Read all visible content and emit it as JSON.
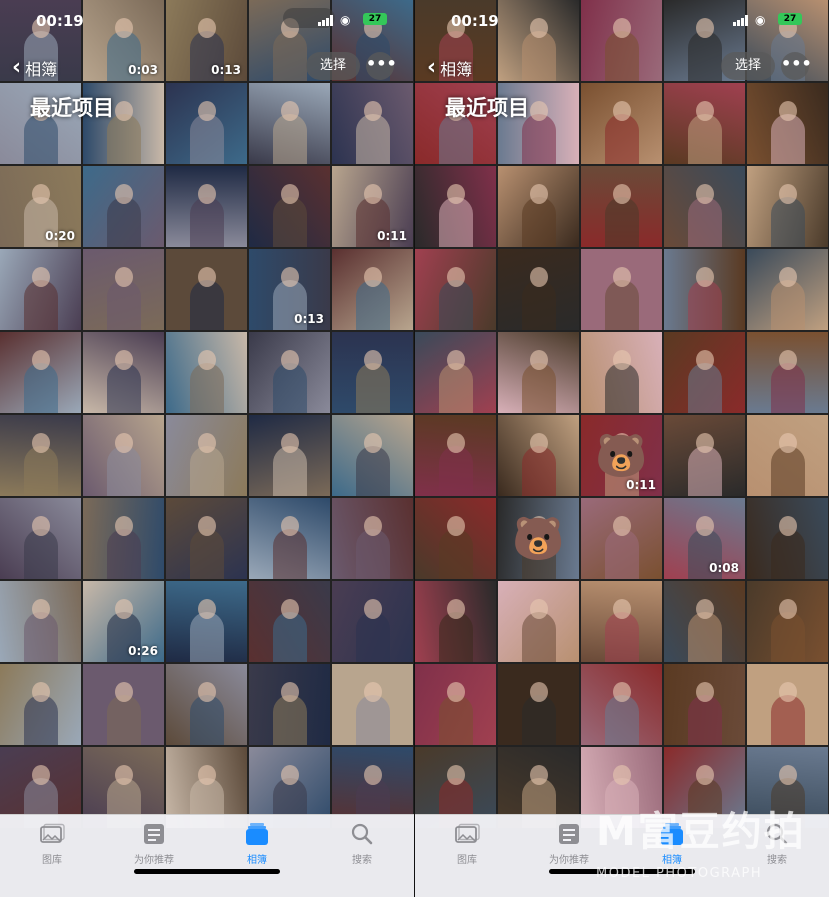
{
  "screens": [
    {
      "time": "00:19",
      "battery": "27",
      "back_label": "相簿",
      "title": "最近项目",
      "select_label": "选择",
      "more_label": "•••",
      "tabs": [
        {
          "label": "图库",
          "icon": "photos-icon",
          "active": false
        },
        {
          "label": "为你推荐",
          "icon": "for-you-icon",
          "active": false
        },
        {
          "label": "相簿",
          "icon": "albums-icon",
          "active": true
        },
        {
          "label": "搜索",
          "icon": "search-icon",
          "active": false
        }
      ],
      "durations": [
        {
          "row": 0,
          "col": 1,
          "text": "0:03"
        },
        {
          "row": 0,
          "col": 2,
          "text": "0:13"
        },
        {
          "row": 2,
          "col": 0,
          "text": "0:20"
        },
        {
          "row": 2,
          "col": 4,
          "text": "0:11"
        },
        {
          "row": 3,
          "col": 3,
          "text": "0:13"
        },
        {
          "row": 7,
          "col": 1,
          "text": "0:26"
        }
      ],
      "bears": []
    },
    {
      "time": "00:19",
      "battery": "27",
      "back_label": "相簿",
      "title": "最近项目",
      "select_label": "选择",
      "more_label": "•••",
      "tabs": [
        {
          "label": "图库",
          "icon": "photos-icon",
          "active": false
        },
        {
          "label": "为你推荐",
          "icon": "for-you-icon",
          "active": false
        },
        {
          "label": "相簿",
          "icon": "albums-icon",
          "active": true
        },
        {
          "label": "搜索",
          "icon": "search-icon",
          "active": false
        }
      ],
      "durations": [
        {
          "row": 5,
          "col": 2,
          "text": "0:11"
        },
        {
          "row": 6,
          "col": 3,
          "text": "0:08"
        }
      ],
      "bears": [
        {
          "row": 5,
          "col": 2
        },
        {
          "row": 6,
          "col": 1
        }
      ]
    }
  ],
  "watermark": {
    "big": "M富豆约拍",
    "small": "MODEL PHOTOGRAPH"
  },
  "colors": {
    "accent": "#1a8cff",
    "left_palette": [
      "#3a3a4a",
      "#6b5a6e",
      "#2c3350",
      "#8a8a9a",
      "#4a3d52",
      "#1f2a44",
      "#7b6a58",
      "#b8a58e",
      "#5c4a3a",
      "#9aa8b8",
      "#2e4a6a",
      "#c8b8a8",
      "#5a3030",
      "#3d6a8a",
      "#8c7a5a"
    ],
    "right_palette": [
      "#5a3a22",
      "#3a2a1e",
      "#7a5030",
      "#8a2a2a",
      "#4a3a2a",
      "#6a4a38",
      "#2a2a2a",
      "#c0a080",
      "#9a6a7a",
      "#a04050",
      "#6a7a90",
      "#d8b0b8",
      "#3a4a5a",
      "#b89070",
      "#80304a"
    ]
  }
}
